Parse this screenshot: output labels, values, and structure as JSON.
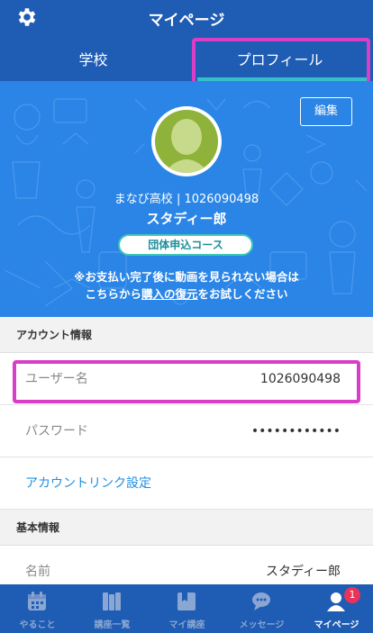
{
  "header": {
    "title": "マイページ",
    "settings_icon": "gear-icon"
  },
  "tabs": [
    {
      "label": "学校",
      "active": false
    },
    {
      "label": "プロフィール",
      "active": true
    }
  ],
  "profile": {
    "edit_label": "編集",
    "school": "まなび高校",
    "user_id": "1026090498",
    "name": "スタディー郎",
    "course": "団体申込コース",
    "notice_line1": "※お支払い完了後に動画を見られない場合は",
    "notice_line2_pre": "こちらから",
    "notice_link": "購入の復元",
    "notice_line2_post": "をお試しください"
  },
  "account": {
    "header": "アカウント情報",
    "username_label": "ユーザー名",
    "username_value": "1026090498",
    "password_label": "パスワード",
    "password_value": "••••••••••••",
    "link_settings_label": "アカウントリンク設定"
  },
  "basic": {
    "header": "基本情報",
    "name_label": "名前",
    "name_value": "スタディー郎"
  },
  "tabbar": {
    "items": [
      {
        "label": "やること",
        "icon": "calendar-icon"
      },
      {
        "label": "講座一覧",
        "icon": "books-icon"
      },
      {
        "label": "マイ講座",
        "icon": "book-icon"
      },
      {
        "label": "メッセージ",
        "icon": "chat-icon"
      },
      {
        "label": "マイページ",
        "icon": "person-icon",
        "badge": "1",
        "active": true
      }
    ]
  },
  "colors": {
    "header_bg": "#1f5cb3",
    "hero_bg": "#2a85e6",
    "accent_teal": "#35c0c9",
    "link_blue": "#1f8fe0",
    "highlight_magenta": "#d63fc6",
    "badge_red": "#e8335a"
  }
}
